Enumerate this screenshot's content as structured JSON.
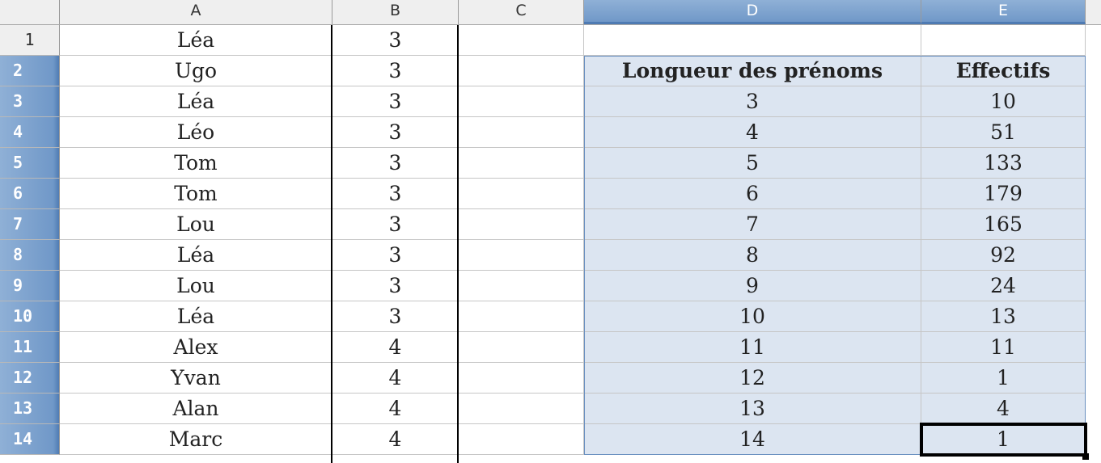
{
  "columns": [
    "A",
    "B",
    "C",
    "D",
    "E"
  ],
  "selected_columns": [
    "D",
    "E"
  ],
  "rows": [
    {
      "num": "1",
      "a": "Léa",
      "b": "3",
      "d": "",
      "e": ""
    },
    {
      "num": "2",
      "a": "Ugo",
      "b": "3",
      "d": "Longueur des prénoms",
      "e": "Effectifs"
    },
    {
      "num": "3",
      "a": "Léa",
      "b": "3",
      "d": "3",
      "e": "10"
    },
    {
      "num": "4",
      "a": "Léo",
      "b": "3",
      "d": "4",
      "e": "51"
    },
    {
      "num": "5",
      "a": "Tom",
      "b": "3",
      "d": "5",
      "e": "133"
    },
    {
      "num": "6",
      "a": "Tom",
      "b": "3",
      "d": "6",
      "e": "179"
    },
    {
      "num": "7",
      "a": "Lou",
      "b": "3",
      "d": "7",
      "e": "165"
    },
    {
      "num": "8",
      "a": "Léa",
      "b": "3",
      "d": "8",
      "e": "92"
    },
    {
      "num": "9",
      "a": "Lou",
      "b": "3",
      "d": "9",
      "e": "24"
    },
    {
      "num": "10",
      "a": "Léa",
      "b": "3",
      "d": "10",
      "e": "13"
    },
    {
      "num": "11",
      "a": "Alex",
      "b": "4",
      "d": "11",
      "e": "11"
    },
    {
      "num": "12",
      "a": "Yvan",
      "b": "4",
      "d": "12",
      "e": "1"
    },
    {
      "num": "13",
      "a": "Alan",
      "b": "4",
      "d": "13",
      "e": "4"
    },
    {
      "num": "14",
      "a": "Marc",
      "b": "4",
      "d": "14",
      "e": "1"
    }
  ],
  "selection": {
    "range": "D2:E14",
    "active_cell": "E14"
  },
  "colors": {
    "selection_fill": "#dce5f1",
    "header_highlight": "#7098c8"
  }
}
